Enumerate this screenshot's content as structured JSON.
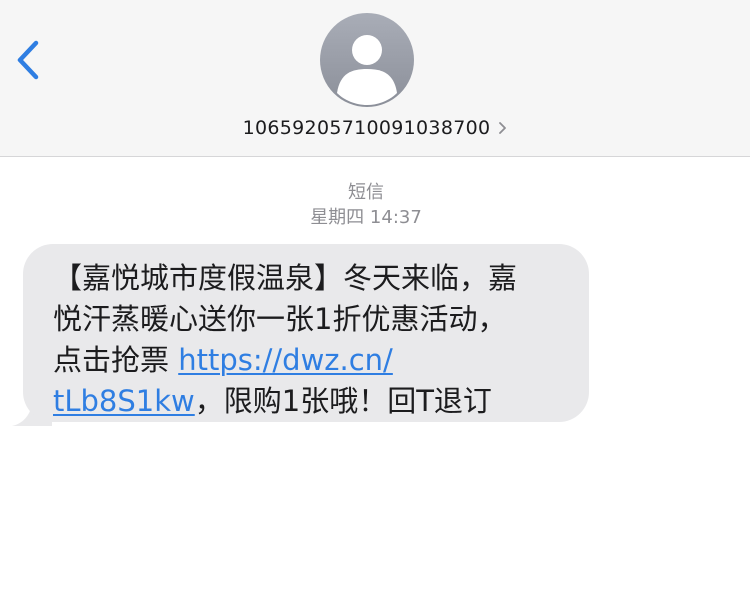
{
  "header": {
    "back_icon": "chevron-left-icon",
    "avatar_icon": "person-silhouette-icon",
    "contact_number": "10659205710091038700",
    "chevron_icon": "chevron-right-icon"
  },
  "meta": {
    "service": "短信",
    "timestamp": "星期四 14:37"
  },
  "message": {
    "line1": "【嘉悦城市度假温泉】冬天来临，嘉",
    "line2": "悦汗蒸暖心送你一张1折优惠活动，",
    "line3_text": "点击抢票 ",
    "line3_link": "https://dwz.cn/",
    "line4_link": "tLb8S1kw",
    "line4_text": "，限购1张哦！回T退订"
  },
  "colors": {
    "header_bg": "#f6f6f6",
    "accent_blue": "#2f7ee2",
    "bubble_bg": "#e9e9eb",
    "meta_gray": "#8e8e93",
    "avatar_gray": "#9a9ea8"
  }
}
